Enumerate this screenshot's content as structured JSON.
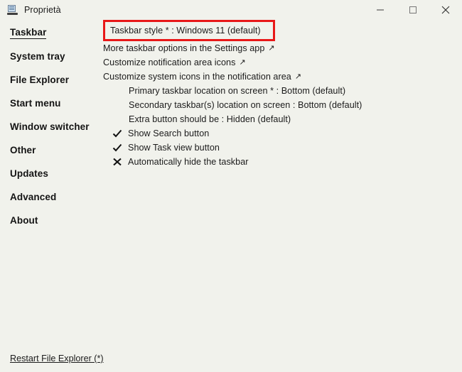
{
  "window": {
    "title": "Proprietà",
    "icon": "taskbar-properties-icon",
    "controls": {
      "minimize_label": "Minimize",
      "maximize_label": "Maximize",
      "close_label": "Close"
    }
  },
  "sidebar": {
    "items": [
      {
        "label": "Taskbar",
        "active": true
      },
      {
        "label": "System tray",
        "active": false
      },
      {
        "label": "File Explorer",
        "active": false
      },
      {
        "label": "Start menu",
        "active": false
      },
      {
        "label": "Window switcher",
        "active": false
      },
      {
        "label": "Other",
        "active": false
      },
      {
        "label": "Updates",
        "active": false
      },
      {
        "label": "Advanced",
        "active": false
      },
      {
        "label": "About",
        "active": false
      }
    ]
  },
  "main": {
    "highlighted_row": {
      "label": "Taskbar style * : Windows 11 (default)",
      "highlight_color": "#e81818"
    },
    "links": [
      {
        "label": "More taskbar options in the Settings app",
        "arrow": "↗"
      },
      {
        "label": "Customize notification area icons",
        "arrow": "↗"
      },
      {
        "label": "Customize system icons in the notification area",
        "arrow": "↗"
      }
    ],
    "indented_rows": [
      {
        "label": "Primary taskbar location on screen * : Bottom (default)"
      },
      {
        "label": "Secondary taskbar(s) location on screen : Bottom (default)"
      },
      {
        "label": "Extra button should be : Hidden (default)"
      }
    ],
    "toggles": [
      {
        "label": "Show Search button",
        "state": "checked",
        "mark": "✓"
      },
      {
        "label": "Show Task view button",
        "state": "checked",
        "mark": "✓"
      },
      {
        "label": "Automatically hide the taskbar",
        "state": "unchecked",
        "mark": "✗"
      }
    ]
  },
  "footer": {
    "restart_label": "Restart File Explorer (*)"
  }
}
